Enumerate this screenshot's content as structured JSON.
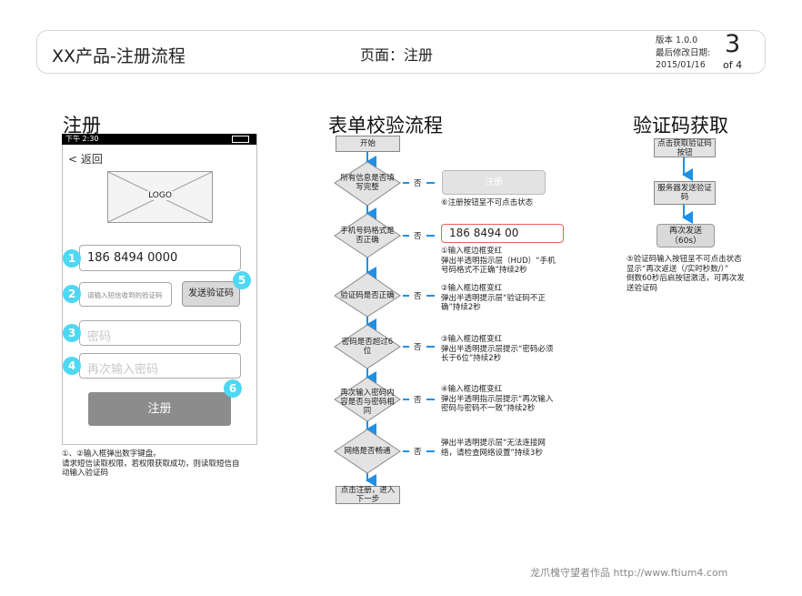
{
  "header": {
    "title": "XX产品-注册流程",
    "page": "页面：注册",
    "version": "版本 1.0.0",
    "modified_label": "最后修改日期:",
    "date": "2015/01/16",
    "page_num": "3",
    "page_of": "of 4"
  },
  "sections": {
    "register": "注册",
    "form_flow": "表单校验流程",
    "code_flow": "验证码获取"
  },
  "phone": {
    "time": "下午 2:30",
    "back": "< 返回",
    "logo": "LOGO",
    "phone_value": "186  8494  0000",
    "code_placeholder": "请输入短信收到的验证码",
    "send_code": "发送验证码",
    "password_placeholder": "密码",
    "password_again_placeholder": "再次输入密码",
    "register": "注册",
    "badges": [
      "1",
      "2",
      "3",
      "4",
      "5",
      "6"
    ]
  },
  "notes": {
    "phone_note": [
      "①、②输入框弹出数字键盘。",
      "请求短信读取权限，若权限获取成功，则读取短信自",
      "动输入验证码"
    ]
  },
  "flow": {
    "start": "开始",
    "end": [
      "点击注册，进入",
      "下一步"
    ],
    "no": "否",
    "decisions": [
      [
        "所有信息是否填",
        "写完整"
      ],
      [
        "手机号码格式是",
        "否正确"
      ],
      [
        "验证码是否正确"
      ],
      [
        "密码是否超过6",
        "位"
      ],
      [
        "再次输入密码内",
        "容是否与密码相",
        "同"
      ],
      [
        "网络是否畅通"
      ]
    ],
    "disabled_btn": "注册",
    "phone_error_value": "186  8494  00",
    "notes": [
      [
        "⑥注册按钮呈不可点击状态"
      ],
      [
        "①输入框边框变红",
        "弹出半透明指示层（HUD）“手机",
        "号码格式不正确”持续2秒"
      ],
      [
        "②输入框边框变红",
        "弹出半透明提示层“验证码不正",
        "确”持续2秒"
      ],
      [
        "③输入框边框变红",
        "弹出半透明提示层提示“密码必须",
        "长于6位”持续2秒"
      ],
      [
        "④输入框边框变红",
        "弹出半透明指示层提示“再次输入",
        "密码与密码不一致”持续2秒"
      ],
      [
        "弹出半透明提示层“无法连接网",
        "络，请检查网络设置”持续3秒"
      ]
    ]
  },
  "code_flow": {
    "step1": [
      "点击获取验证码",
      "按钮"
    ],
    "step2": [
      "服务器发送验证",
      "码"
    ],
    "step3": [
      "再次发送",
      "（60s）"
    ],
    "note": [
      "⑤验证码输入按钮呈不可点击状态",
      "显示“再次返送（/实时秒数/）”",
      "倒数60秒后启按钮激活，可再次发",
      "送验证码"
    ]
  },
  "footer": "龙爪槐守望者作品  http://www.ftium4.com",
  "colors": {
    "accent": "#4ed8f3",
    "arrow": "#1e90e6",
    "error_border": "#e0645a",
    "button_gray": "#8c8c8c"
  }
}
